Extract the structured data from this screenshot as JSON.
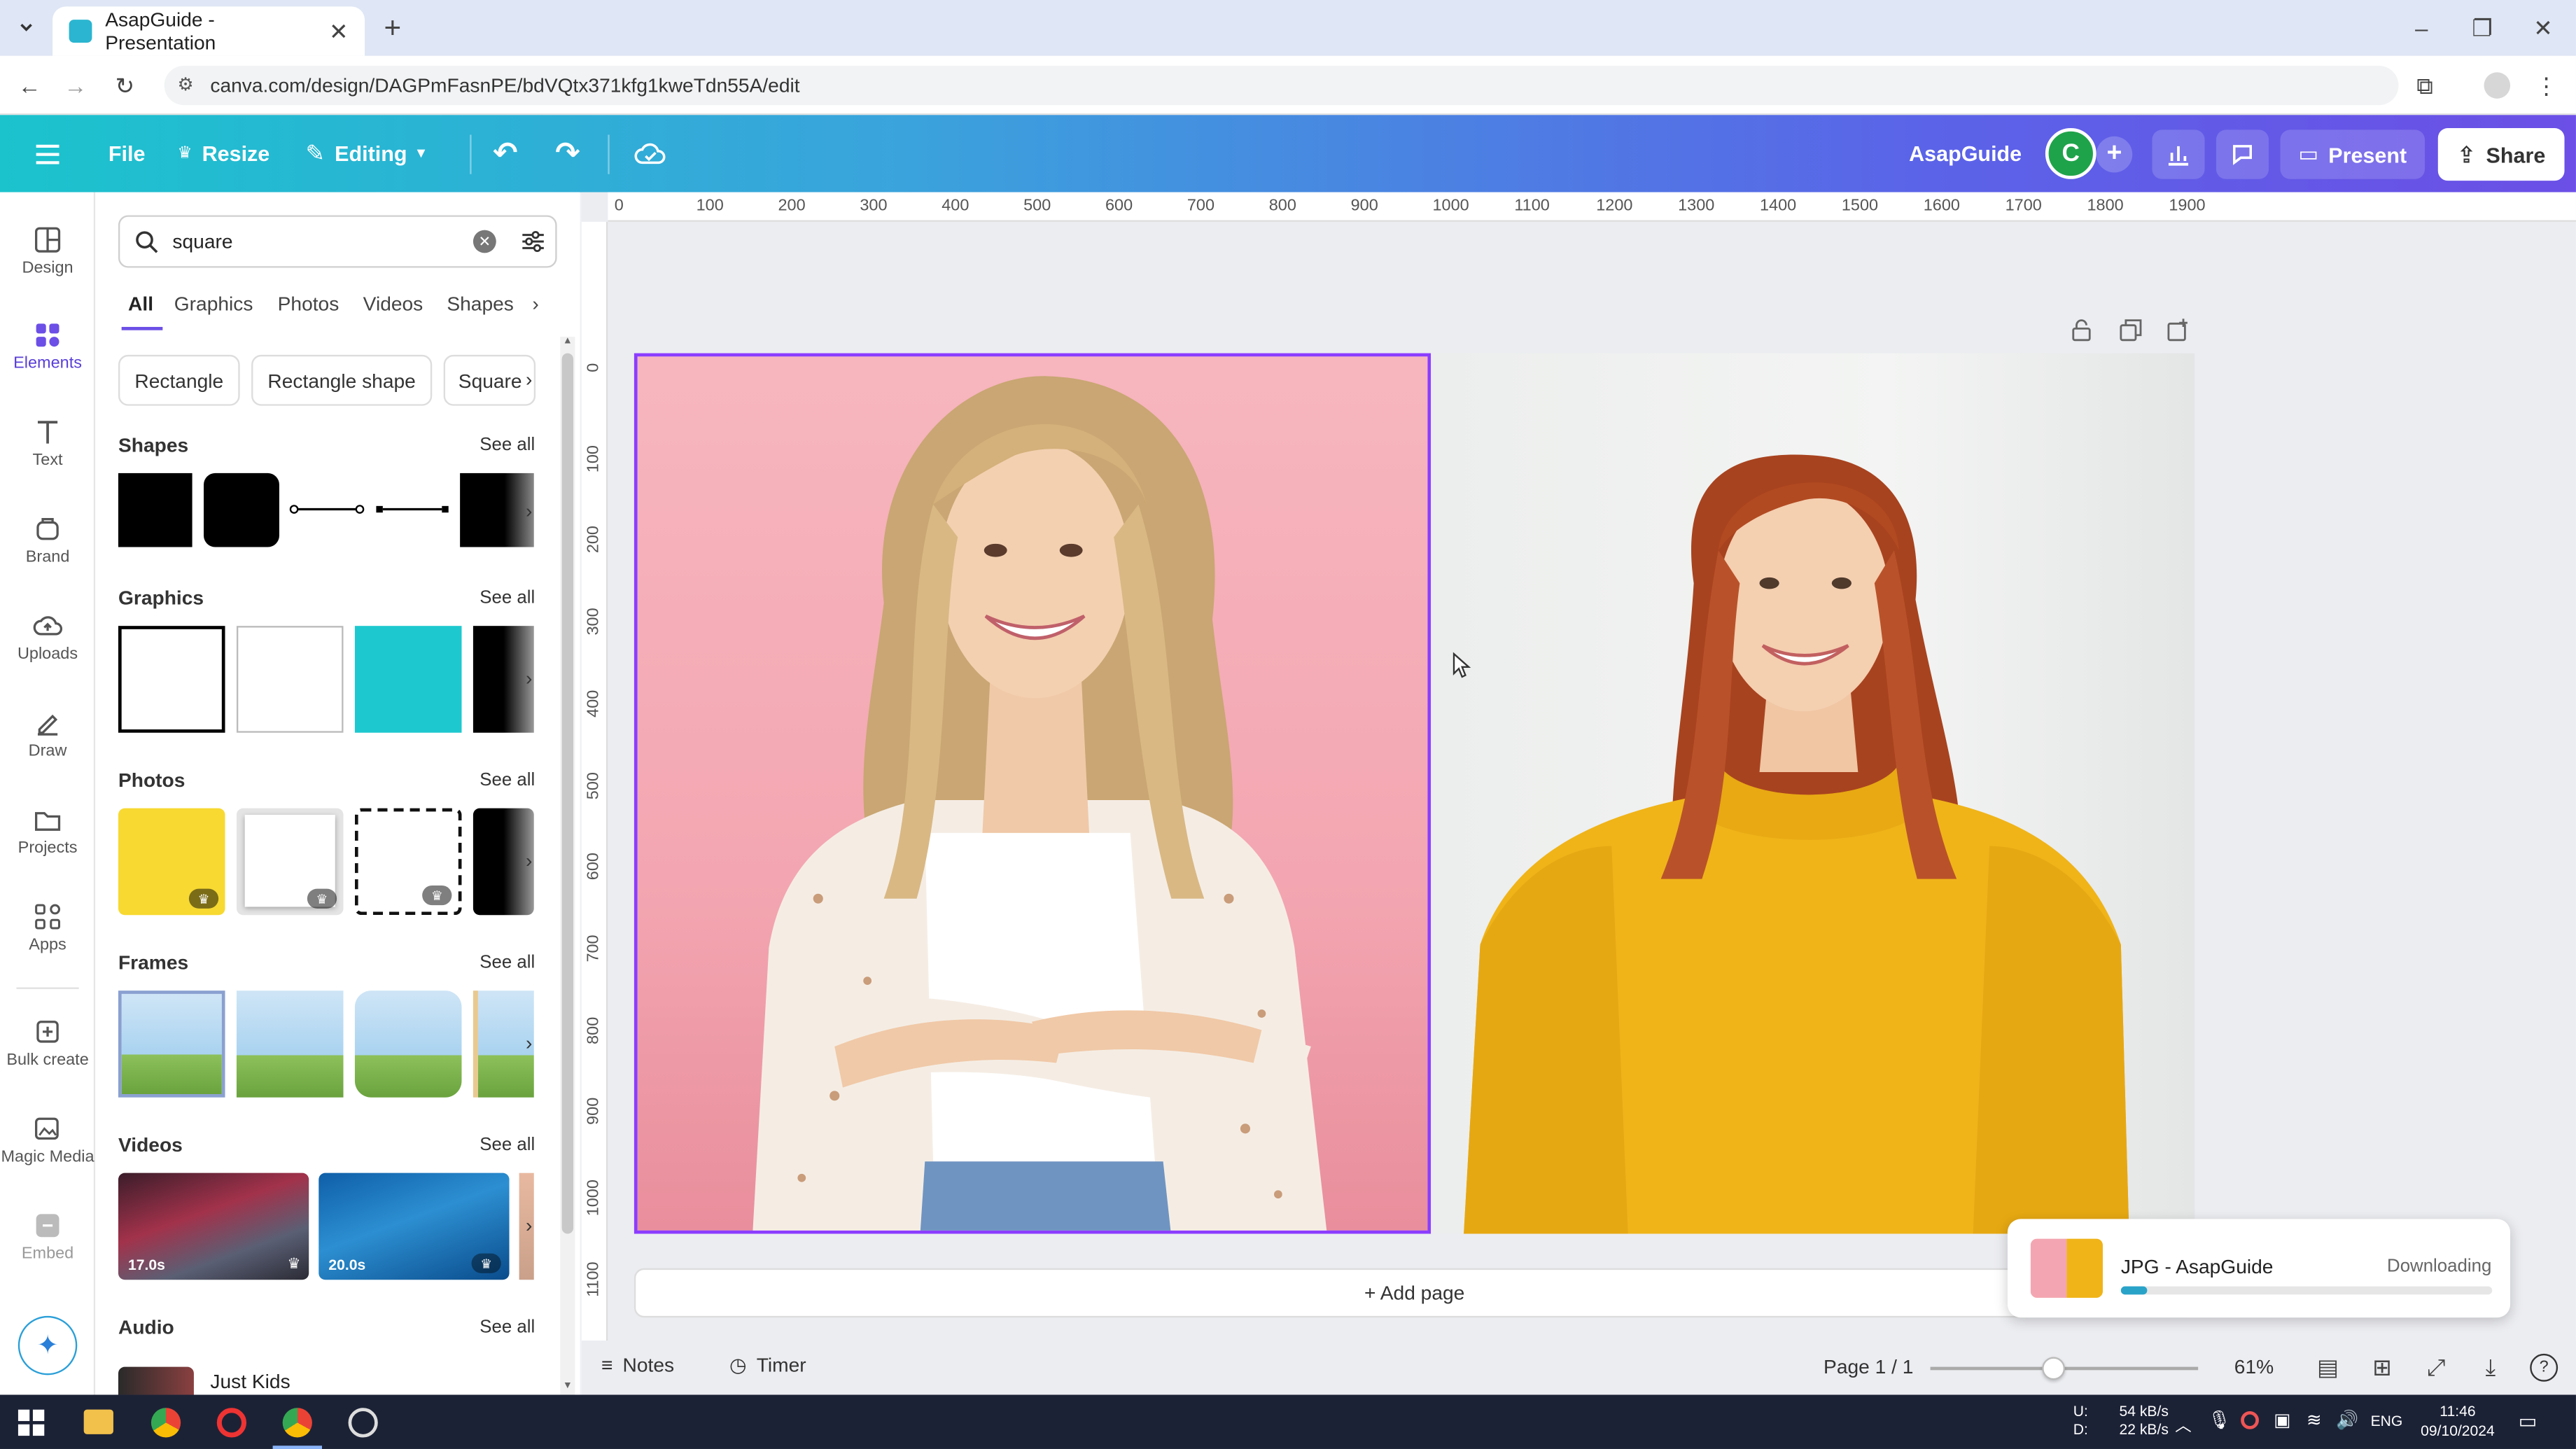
{
  "browser": {
    "tab_title": "AsapGuide - Presentation",
    "url": "canva.com/design/DAGPmFasnPE/bdVQtx371kfg1kweTdn55A/edit"
  },
  "topbar": {
    "file": "File",
    "resize": "Resize",
    "editing": "Editing",
    "project_name": "AsapGuide",
    "avatar_letter": "C",
    "present": "Present",
    "share": "Share"
  },
  "rail": {
    "items": [
      {
        "label": "Design",
        "icon": "layout-icon"
      },
      {
        "label": "Elements",
        "icon": "shapes-icon"
      },
      {
        "label": "Text",
        "icon": "text-icon"
      },
      {
        "label": "Brand",
        "icon": "brand-icon"
      },
      {
        "label": "Uploads",
        "icon": "cloud-upload-icon"
      },
      {
        "label": "Draw",
        "icon": "pen-icon"
      },
      {
        "label": "Projects",
        "icon": "folder-icon"
      },
      {
        "label": "Apps",
        "icon": "apps-icon"
      },
      {
        "label": "Bulk create",
        "icon": "bulk-create-icon"
      },
      {
        "label": "Magic Media",
        "icon": "magic-media-icon"
      },
      {
        "label": "Embed",
        "icon": "embed-icon"
      }
    ]
  },
  "panel": {
    "search_value": "square",
    "tabs": [
      "All",
      "Graphics",
      "Photos",
      "Videos",
      "Shapes"
    ],
    "chips": [
      "Rectangle",
      "Rectangle shape",
      "Square"
    ],
    "sections": {
      "shapes": "Shapes",
      "graphics": "Graphics",
      "photos": "Photos",
      "frames": "Frames",
      "videos": "Videos",
      "audio": "Audio"
    },
    "see_all": "See all",
    "video_durations": [
      "17.0s",
      "20.0s"
    ],
    "audio_track": "Just Kids"
  },
  "ruler": {
    "top_ticks": [
      "0",
      "100",
      "200",
      "300",
      "400",
      "500",
      "600",
      "700",
      "800",
      "900",
      "1000",
      "1100",
      "1200",
      "1300",
      "1400",
      "1500",
      "1600",
      "1700",
      "1800",
      "1900"
    ],
    "left_ticks": [
      "0",
      "100",
      "200",
      "300",
      "400",
      "500",
      "600",
      "700",
      "800",
      "900",
      "1000",
      "1100"
    ]
  },
  "canvas": {
    "add_page": "+ Add page"
  },
  "download": {
    "title": "JPG - AsapGuide",
    "status": "Downloading",
    "progress": 0.07
  },
  "bottom": {
    "notes": "Notes",
    "timer": "Timer",
    "page": "Page 1 / 1",
    "zoom": "61%"
  },
  "taskbar": {
    "net_up_label": "U:",
    "net_down_label": "D:",
    "net_up": "54 kB/s",
    "net_down": "22 kB/s",
    "lang": "ENG",
    "time": "11:46",
    "date": "09/10/2024"
  },
  "colors": {
    "accent": "#8b3dff",
    "topbar_start": "#1bc3cd",
    "topbar_end": "#6b4fe6",
    "teal": "#1ec8cf",
    "avatar": "#1fa34a"
  }
}
